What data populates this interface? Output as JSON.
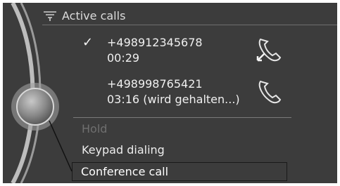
{
  "header": {
    "title": "Active calls",
    "icon": "phone-settings-icon"
  },
  "calls": [
    {
      "checked": true,
      "number": "+498912345678",
      "status": "00:29",
      "icon": "handset-swap-icon"
    },
    {
      "checked": false,
      "number": "+498998765421",
      "status": "03:16 (wird gehalten...)",
      "icon": "handset-icon"
    }
  ],
  "menu": {
    "hold": "Hold",
    "keypad": "Keypad dialing",
    "conference": "Conference call"
  },
  "colors": {
    "background": "#3c3c3c",
    "text": "#ededed",
    "disabled": "#6f6f6f"
  }
}
